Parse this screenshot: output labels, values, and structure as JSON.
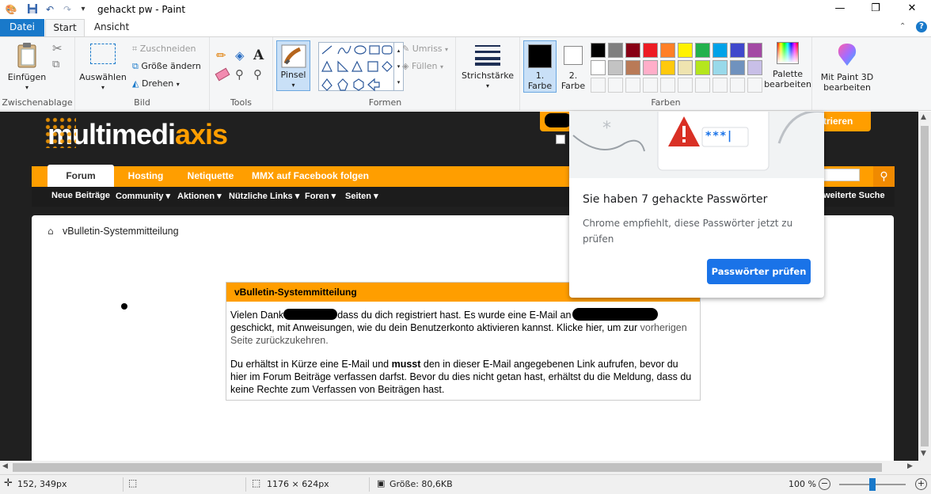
{
  "window": {
    "title": "gehackt pw - Paint",
    "minimize": "—",
    "maximize": "❐",
    "close": "✕"
  },
  "tabs": {
    "file": "Datei",
    "start": "Start",
    "view": "Ansicht"
  },
  "ribbon": {
    "clipboard": {
      "paste": "Einfügen",
      "label": "Zwischenablage"
    },
    "image": {
      "select": "Auswählen",
      "crop": "Zuschneiden",
      "resize": "Größe ändern",
      "rotate": "Drehen",
      "label": "Bild"
    },
    "tools": {
      "label": "Tools"
    },
    "brushes": {
      "label": "Pinsel"
    },
    "shapes": {
      "outline": "Umriss",
      "fill": "Füllen",
      "label": "Formen"
    },
    "size": {
      "label": "Strichstärke"
    },
    "colors": {
      "color1": "1.\nFarbe",
      "color1_a": "1.",
      "color1_b": "Farbe",
      "color2_a": "2.",
      "color2_b": "Farbe",
      "edit": "Palette bearbeiten",
      "edit_a": "Palette",
      "edit_b": "bearbeiten",
      "label": "Farben",
      "palette_row1": [
        "#000000",
        "#7f7f7f",
        "#880015",
        "#ed1c24",
        "#ff7f27",
        "#fff200",
        "#22b14c",
        "#00a2e8",
        "#3f48cc",
        "#a349a4"
      ],
      "palette_row2": [
        "#ffffff",
        "#c3c3c3",
        "#b97a57",
        "#ffaec9",
        "#ffc90e",
        "#efe4b0",
        "#b5e61d",
        "#99d9ea",
        "#7092be",
        "#c8bfe7"
      ]
    },
    "paint3d": {
      "a": "Mit Paint 3D",
      "b": "bearbeiten"
    }
  },
  "webpage": {
    "logo_a": "multimedi",
    "logo_b": "axis",
    "register": "istrieren",
    "nav_tabs": [
      "Forum",
      "Hosting",
      "Netiquette",
      "MMX auf Facebook folgen"
    ],
    "subnav": [
      "Neue Beiträge",
      "Community ▾",
      "Aktionen ▾",
      "Nützliche Links ▾",
      "Foren ▾",
      "Seiten ▾"
    ],
    "advanced_search": "weiterte Suche",
    "breadcrumb": "vBulletin-Systemmitteilung",
    "message": {
      "title": "vBulletin-Systemmitteilung",
      "p1_a": "Vielen Dank",
      "p1_b": "dass du dich registriert hast. Es wurde eine E-Mail an",
      "p1_c": "geschickt, mit Anweisungen, wie du dein Benutzerkonto aktivieren kannst. Klicke hier, um zur",
      "p1_link": "vorherigen Seite zurückzukehren.",
      "p2_a": "Du erhältst in Kürze eine E-Mail und ",
      "p2_bold": "musst",
      "p2_b": " den in dieser E-Mail angegebenen Link aufrufen, bevor du hier im Forum Beiträge verfassen darfst. Bevor du dies nicht getan hast, erhältst du die Meldung, dass du keine Rechte zum Verfassen von Beiträgen hast."
    }
  },
  "popup": {
    "title": "Sie haben 7 gehackte Passwörter",
    "body": "Chrome empfiehlt, diese Passwörter jetzt zu prüfen",
    "button": "Passwörter prüfen",
    "stars": "***|"
  },
  "statusbar": {
    "cursor": "152, 349px",
    "dimensions": "1176 × 624px",
    "size": "Größe: 80,6KB",
    "zoom": "100 %",
    "zoom_level": 1.0
  },
  "colors": {
    "accent": "#1979ca",
    "orange": "#ff9e00",
    "chrome_blue": "#1a73e8"
  }
}
